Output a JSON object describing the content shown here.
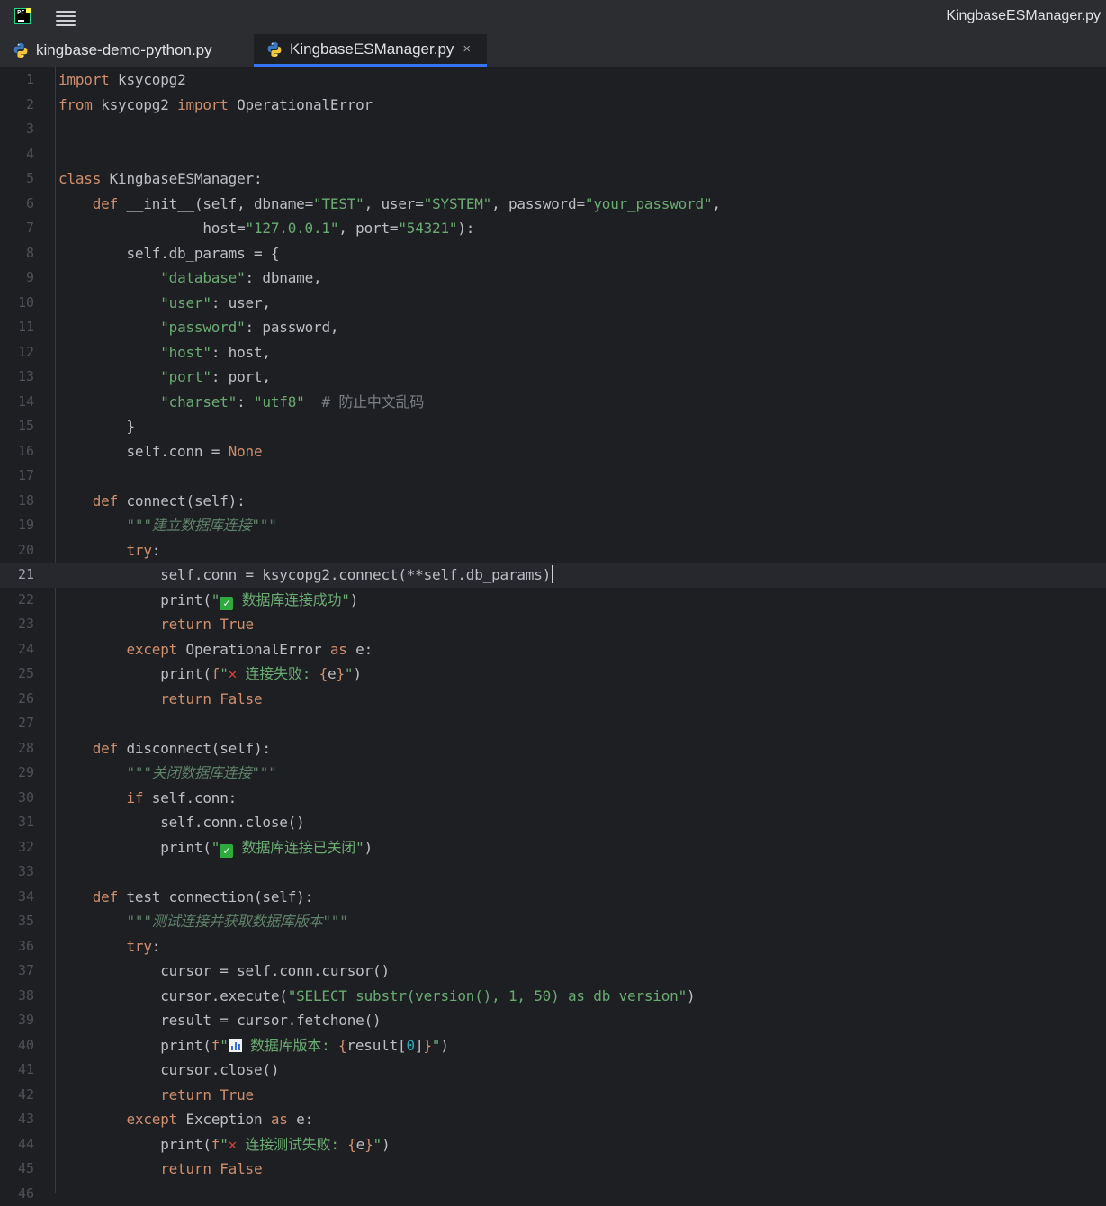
{
  "window": {
    "title": "KingbaseESManager.py"
  },
  "tabs": [
    {
      "label": "kingbase-demo-python.py",
      "icon": "python-file-icon",
      "active": false
    },
    {
      "label": "KingbaseESManager.py",
      "icon": "python-file-icon",
      "active": true,
      "close": "×"
    }
  ],
  "editor": {
    "current_line": 21,
    "line_numbers": [
      "1",
      "2",
      "3",
      "4",
      "5",
      "6",
      "7",
      "8",
      "9",
      "10",
      "11",
      "12",
      "13",
      "14",
      "15",
      "16",
      "17",
      "18",
      "19",
      "20",
      "21",
      "22",
      "23",
      "24",
      "25",
      "26",
      "27",
      "28",
      "29",
      "30",
      "31",
      "32",
      "33",
      "34",
      "35",
      "36",
      "37",
      "38",
      "39",
      "40",
      "41",
      "42",
      "43",
      "44",
      "45",
      "46"
    ],
    "lines": [
      "import ksycopg2",
      "from ksycopg2 import OperationalError",
      "",
      "",
      "class KingbaseESManager:",
      "    def __init__(self, dbname=\"TEST\", user=\"SYSTEM\", password=\"your_password\",",
      "                 host=\"127.0.0.1\", port=\"54321\"):",
      "        self.db_params = {",
      "            \"database\": dbname,",
      "            \"user\": user,",
      "            \"password\": password,",
      "            \"host\": host,",
      "            \"port\": port,",
      "            \"charset\": \"utf8\"  # 防止中文乱码",
      "        }",
      "        self.conn = None",
      "",
      "    def connect(self):",
      "        \"\"\"建立数据库连接\"\"\"",
      "        try:",
      "            self.conn = ksycopg2.connect(**self.db_params)",
      "            print(\"✅ 数据库连接成功\")",
      "            return True",
      "        except OperationalError as e:",
      "            print(f\"❌ 连接失败: {e}\")",
      "            return False",
      "",
      "    def disconnect(self):",
      "        \"\"\"关闭数据库连接\"\"\"",
      "        if self.conn:",
      "            self.conn.close()",
      "            print(\"✅ 数据库连接已关闭\")",
      "",
      "    def test_connection(self):",
      "        \"\"\"测试连接并获取数据库版本\"\"\"",
      "        try:",
      "            cursor = self.conn.cursor()",
      "            cursor.execute(\"SELECT substr(version(), 1, 50) as db_version\")",
      "            result = cursor.fetchone()",
      "            print(f\"📊 数据库版本: {result[0]}\")",
      "            cursor.close()",
      "            return True",
      "        except Exception as e:",
      "            print(f\"❌ 连接测试失败: {e}\")",
      "            return False",
      ""
    ]
  },
  "colors": {
    "background": "#1e1f22",
    "keyword": "#cf8e6d",
    "string": "#6aab73",
    "comment": "#7a7e85",
    "docstring": "#5f826b",
    "number": "#2aacb8",
    "accent": "#3574f0"
  }
}
